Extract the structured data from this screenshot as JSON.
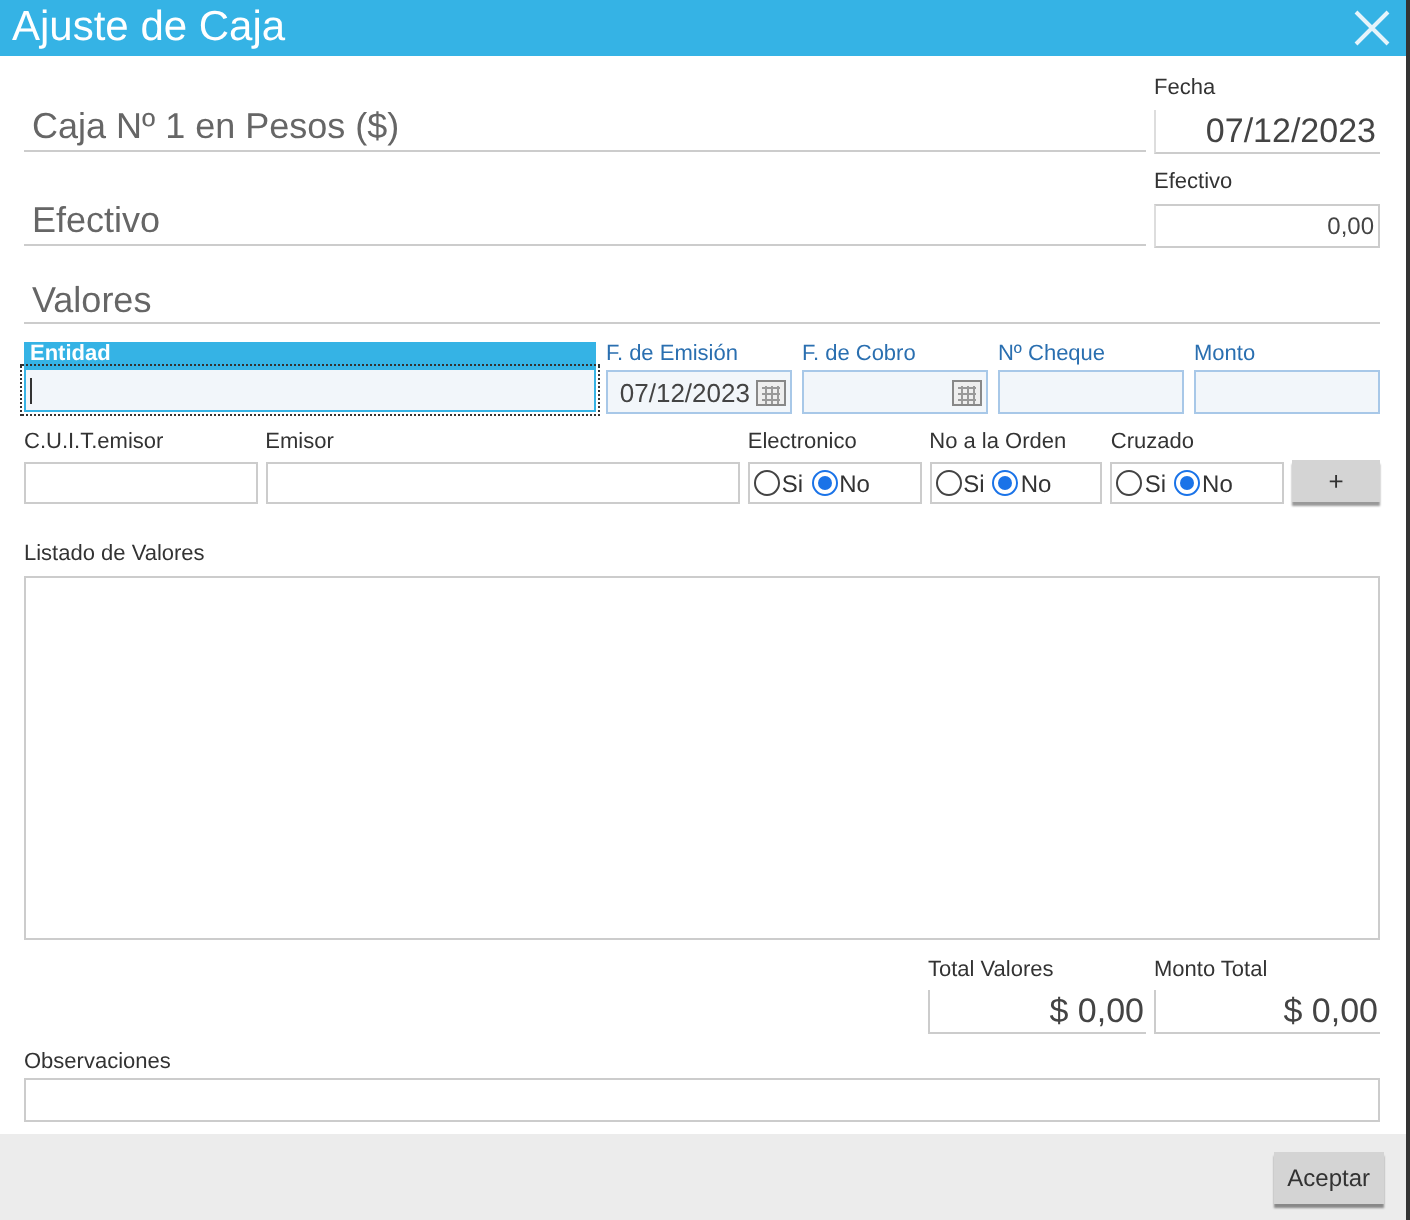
{
  "window": {
    "title": "Ajuste de Caja"
  },
  "header_rows": [
    {
      "heading": "Caja Nº 1 en Pesos ($)",
      "field_label": "Fecha",
      "value": "07/12/2023",
      "kind": "flat"
    },
    {
      "heading": "Efectivo",
      "field_label": "Efectivo",
      "value": "0,00",
      "kind": "boxed"
    }
  ],
  "valores": {
    "heading": "Valores",
    "cheque_fields": [
      {
        "label": "Entidad",
        "kind": "text",
        "focused": true
      },
      {
        "label": "F. de Emisión",
        "kind": "date",
        "value": "07/12/2023",
        "focused": false
      },
      {
        "label": "F. de Cobro",
        "kind": "date",
        "focused": false
      },
      {
        "label": "Nº Cheque",
        "kind": "text",
        "focused": false
      },
      {
        "label": "Monto",
        "kind": "text",
        "focused": false
      }
    ],
    "issuer_fields": [
      {
        "label": "C.U.I.T.emisor"
      },
      {
        "label": "Emisor"
      }
    ],
    "radio_groups": [
      {
        "label": "Electronico",
        "options": [
          {
            "label": "Si",
            "selected": false
          },
          {
            "label": "No",
            "selected": true
          }
        ]
      },
      {
        "label": "No a la Orden",
        "options": [
          {
            "label": "Si",
            "selected": false
          },
          {
            "label": "No",
            "selected": true
          }
        ]
      },
      {
        "label": "Cruzado",
        "options": [
          {
            "label": "Si",
            "selected": false
          },
          {
            "label": "No",
            "selected": true
          }
        ]
      }
    ],
    "add_button": "+",
    "list_label": "Listado de Valores"
  },
  "totals": [
    {
      "label": "Total Valores",
      "value": "$ 0,00"
    },
    {
      "label": "Monto Total",
      "value": "$ 0,00"
    }
  ],
  "observaciones": {
    "label": "Observaciones"
  },
  "buttons": [
    "Aceptar"
  ]
}
